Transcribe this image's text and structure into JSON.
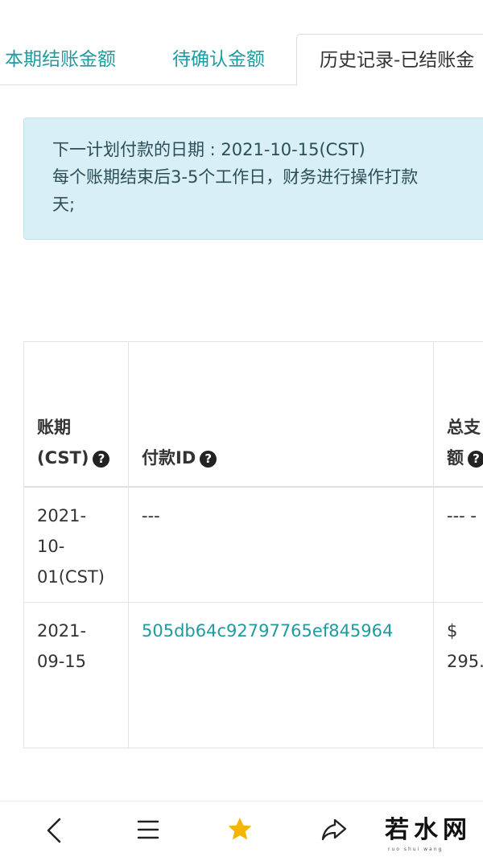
{
  "tabs": [
    {
      "label": "本期结账金额",
      "active": false
    },
    {
      "label": "待确认金额",
      "active": false
    },
    {
      "label": "历史记录-已结账金",
      "active": true
    }
  ],
  "notice": {
    "line1": "下一计划付款的日期 : 2021-10-15(CST)",
    "line2": "每个账期结束后3-5个工作日，财务进行操作打款",
    "line3": "天;"
  },
  "table": {
    "headers": {
      "period_line1": "账期",
      "period_line2": "(CST)",
      "payment_id": "付款ID",
      "total_line1": "总支",
      "total_line2": "额"
    },
    "rows": [
      {
        "period_lines": [
          "2021-",
          "10-",
          "01(CST)"
        ],
        "payment_id": "---",
        "total_lines": [
          "--- -"
        ]
      },
      {
        "period_lines": [
          "2021-",
          "09-15"
        ],
        "payment_id": "505db64c92797765ef845964",
        "total_lines": [
          "$",
          "295."
        ]
      }
    ]
  },
  "bottom_bar": {
    "icons": [
      "back-icon",
      "menu-icon",
      "star-icon",
      "share-icon"
    ],
    "watermark": "若水网",
    "watermark_sub": "ruo shui wang"
  },
  "colors": {
    "accent": "#1f9aa0",
    "notice_bg": "#d9eff6",
    "star": "#f5b400"
  }
}
